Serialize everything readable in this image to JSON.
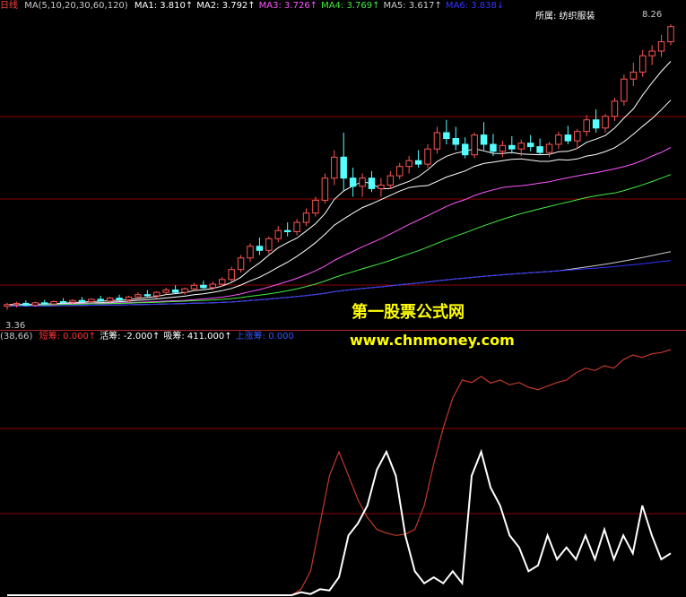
{
  "header_top": {
    "period": "日线",
    "ma_label": "MA(5,10,20,30,60,120)",
    "items": [
      {
        "name": "MA1:",
        "value": "3.810",
        "arrow": "↑",
        "color": "#ffffff"
      },
      {
        "name": "MA2:",
        "value": "3.792",
        "arrow": "↑",
        "color": "#ffffff"
      },
      {
        "name": "MA3:",
        "value": "3.726",
        "arrow": "↑",
        "color": "#ff55ff"
      },
      {
        "name": "MA4:",
        "value": "3.769",
        "arrow": "↑",
        "color": "#44ee44"
      },
      {
        "name": "MA5:",
        "value": "3.617",
        "arrow": "↑",
        "color": "#cccccc"
      },
      {
        "name": "MA6:",
        "value": "3.838",
        "arrow": "↓",
        "color": "#3333ff"
      }
    ]
  },
  "industry": "所属: 纺织服装",
  "high_label": "8.26",
  "low_label": "3.36",
  "header_bottom": {
    "params": "(38,66)",
    "items": [
      {
        "name": "短筹:",
        "value": "0.000",
        "arrow": "↑",
        "color": "#ff3333"
      },
      {
        "name": "活筹:",
        "value": "-2.000",
        "arrow": "↑",
        "color": "#ffffff"
      },
      {
        "name": "吸筹:",
        "value": "411.000",
        "arrow": "↑",
        "color": "#ffffff"
      },
      {
        "name": "上涨筹:",
        "value": "0.000",
        "arrow": "",
        "color": "#3355ff"
      }
    ]
  },
  "watermark": {
    "line1": "第一股票公式网",
    "line2": "www.chnmoney.com"
  },
  "colors": {
    "up": "#ff5555",
    "down": "#55ffff",
    "grid": "#8b0000",
    "ma1": "#ffffff",
    "ma3": "#ff55ff",
    "ma4": "#44ee44",
    "ma5": "#cccccc",
    "ma6": "#3333ff",
    "osc_white": "#ffffff",
    "osc_red": "#c0392b"
  },
  "chart_data": [
    {
      "type": "candlestick",
      "ylim": [
        3.2,
        8.4
      ],
      "log_scale": false,
      "candles": [
        {
          "o": 3.42,
          "h": 3.48,
          "l": 3.36,
          "c": 3.45
        },
        {
          "o": 3.45,
          "h": 3.5,
          "l": 3.4,
          "c": 3.47
        },
        {
          "o": 3.47,
          "h": 3.52,
          "l": 3.42,
          "c": 3.44
        },
        {
          "o": 3.44,
          "h": 3.5,
          "l": 3.41,
          "c": 3.48
        },
        {
          "o": 3.48,
          "h": 3.53,
          "l": 3.44,
          "c": 3.46
        },
        {
          "o": 3.46,
          "h": 3.52,
          "l": 3.43,
          "c": 3.5
        },
        {
          "o": 3.5,
          "h": 3.56,
          "l": 3.46,
          "c": 3.49
        },
        {
          "o": 3.49,
          "h": 3.54,
          "l": 3.45,
          "c": 3.52
        },
        {
          "o": 3.52,
          "h": 3.58,
          "l": 3.48,
          "c": 3.5
        },
        {
          "o": 3.5,
          "h": 3.56,
          "l": 3.47,
          "c": 3.54
        },
        {
          "o": 3.54,
          "h": 3.6,
          "l": 3.5,
          "c": 3.51
        },
        {
          "o": 3.51,
          "h": 3.58,
          "l": 3.48,
          "c": 3.56
        },
        {
          "o": 3.56,
          "h": 3.62,
          "l": 3.52,
          "c": 3.53
        },
        {
          "o": 3.53,
          "h": 3.6,
          "l": 3.5,
          "c": 3.58
        },
        {
          "o": 3.58,
          "h": 3.66,
          "l": 3.54,
          "c": 3.62
        },
        {
          "o": 3.62,
          "h": 3.7,
          "l": 3.58,
          "c": 3.6
        },
        {
          "o": 3.6,
          "h": 3.68,
          "l": 3.56,
          "c": 3.66
        },
        {
          "o": 3.66,
          "h": 3.74,
          "l": 3.62,
          "c": 3.7
        },
        {
          "o": 3.7,
          "h": 3.78,
          "l": 3.64,
          "c": 3.66
        },
        {
          "o": 3.66,
          "h": 3.74,
          "l": 3.62,
          "c": 3.72
        },
        {
          "o": 3.72,
          "h": 3.82,
          "l": 3.68,
          "c": 3.78
        },
        {
          "o": 3.78,
          "h": 3.86,
          "l": 3.72,
          "c": 3.74
        },
        {
          "o": 3.74,
          "h": 3.84,
          "l": 3.7,
          "c": 3.8
        },
        {
          "o": 3.8,
          "h": 3.92,
          "l": 3.76,
          "c": 3.88
        },
        {
          "o": 3.88,
          "h": 4.1,
          "l": 3.84,
          "c": 4.05
        },
        {
          "o": 4.05,
          "h": 4.3,
          "l": 4.0,
          "c": 4.25
        },
        {
          "o": 4.25,
          "h": 4.5,
          "l": 4.18,
          "c": 4.45
        },
        {
          "o": 4.45,
          "h": 4.6,
          "l": 4.3,
          "c": 4.38
        },
        {
          "o": 4.38,
          "h": 4.62,
          "l": 4.32,
          "c": 4.58
        },
        {
          "o": 4.58,
          "h": 4.8,
          "l": 4.52,
          "c": 4.72
        },
        {
          "o": 4.72,
          "h": 4.86,
          "l": 4.62,
          "c": 4.7
        },
        {
          "o": 4.7,
          "h": 4.92,
          "l": 4.64,
          "c": 4.86
        },
        {
          "o": 4.86,
          "h": 5.1,
          "l": 4.8,
          "c": 5.02
        },
        {
          "o": 5.02,
          "h": 5.3,
          "l": 4.96,
          "c": 5.24
        },
        {
          "o": 5.24,
          "h": 5.7,
          "l": 5.18,
          "c": 5.62
        },
        {
          "o": 5.62,
          "h": 6.1,
          "l": 5.5,
          "c": 5.98
        },
        {
          "o": 5.98,
          "h": 6.4,
          "l": 5.4,
          "c": 5.62
        },
        {
          "o": 5.62,
          "h": 5.8,
          "l": 5.3,
          "c": 5.48
        },
        {
          "o": 5.48,
          "h": 5.7,
          "l": 5.3,
          "c": 5.62
        },
        {
          "o": 5.62,
          "h": 5.74,
          "l": 5.38,
          "c": 5.44
        },
        {
          "o": 5.44,
          "h": 5.62,
          "l": 5.3,
          "c": 5.5
        },
        {
          "o": 5.5,
          "h": 5.74,
          "l": 5.44,
          "c": 5.66
        },
        {
          "o": 5.66,
          "h": 5.88,
          "l": 5.6,
          "c": 5.82
        },
        {
          "o": 5.82,
          "h": 6.0,
          "l": 5.7,
          "c": 5.92
        },
        {
          "o": 5.92,
          "h": 6.1,
          "l": 5.8,
          "c": 5.86
        },
        {
          "o": 5.86,
          "h": 6.2,
          "l": 5.8,
          "c": 6.12
        },
        {
          "o": 6.12,
          "h": 6.5,
          "l": 6.04,
          "c": 6.4
        },
        {
          "o": 6.4,
          "h": 6.62,
          "l": 6.2,
          "c": 6.3
        },
        {
          "o": 6.3,
          "h": 6.5,
          "l": 6.1,
          "c": 6.2
        },
        {
          "o": 6.2,
          "h": 6.32,
          "l": 5.96,
          "c": 6.02
        },
        {
          "o": 6.02,
          "h": 6.4,
          "l": 5.96,
          "c": 6.36
        },
        {
          "o": 6.36,
          "h": 6.58,
          "l": 6.1,
          "c": 6.2
        },
        {
          "o": 6.2,
          "h": 6.38,
          "l": 6.0,
          "c": 6.08
        },
        {
          "o": 6.08,
          "h": 6.26,
          "l": 5.98,
          "c": 6.18
        },
        {
          "o": 6.18,
          "h": 6.34,
          "l": 6.04,
          "c": 6.12
        },
        {
          "o": 6.12,
          "h": 6.28,
          "l": 6.0,
          "c": 6.22
        },
        {
          "o": 6.22,
          "h": 6.36,
          "l": 6.08,
          "c": 6.16
        },
        {
          "o": 6.16,
          "h": 6.3,
          "l": 6.02,
          "c": 6.06
        },
        {
          "o": 6.06,
          "h": 6.24,
          "l": 5.98,
          "c": 6.2
        },
        {
          "o": 6.2,
          "h": 6.42,
          "l": 6.12,
          "c": 6.36
        },
        {
          "o": 6.36,
          "h": 6.52,
          "l": 6.2,
          "c": 6.26
        },
        {
          "o": 6.26,
          "h": 6.46,
          "l": 6.12,
          "c": 6.42
        },
        {
          "o": 6.42,
          "h": 6.7,
          "l": 6.34,
          "c": 6.62
        },
        {
          "o": 6.62,
          "h": 6.8,
          "l": 6.4,
          "c": 6.48
        },
        {
          "o": 6.48,
          "h": 6.72,
          "l": 6.4,
          "c": 6.68
        },
        {
          "o": 6.68,
          "h": 7.0,
          "l": 6.6,
          "c": 6.94
        },
        {
          "o": 6.94,
          "h": 7.4,
          "l": 6.86,
          "c": 7.32
        },
        {
          "o": 7.32,
          "h": 7.6,
          "l": 7.2,
          "c": 7.44
        },
        {
          "o": 7.44,
          "h": 7.82,
          "l": 7.36,
          "c": 7.72
        },
        {
          "o": 7.72,
          "h": 7.9,
          "l": 7.56,
          "c": 7.8
        },
        {
          "o": 7.8,
          "h": 8.08,
          "l": 7.7,
          "c": 7.96
        },
        {
          "o": 7.96,
          "h": 8.26,
          "l": 7.9,
          "c": 8.22
        }
      ],
      "ma": [
        {
          "name": "MA1",
          "period": 5,
          "color_key": "ma1"
        },
        {
          "name": "MA2",
          "period": 10,
          "color_key": "ma1"
        },
        {
          "name": "MA3",
          "period": 20,
          "color_key": "ma3"
        },
        {
          "name": "MA4",
          "period": 30,
          "color_key": "ma4"
        },
        {
          "name": "MA5",
          "period": 60,
          "color_key": "ma5"
        },
        {
          "name": "MA6",
          "period": 120,
          "color_key": "ma6"
        }
      ]
    },
    {
      "type": "line",
      "ylim": [
        0,
        420
      ],
      "series": [
        {
          "name": "吸筹",
          "color_key": "osc_red",
          "values": [
            0,
            0,
            0,
            0,
            0,
            0,
            0,
            0,
            0,
            0,
            0,
            0,
            0,
            0,
            0,
            0,
            0,
            0,
            0,
            0,
            0,
            0,
            0,
            0,
            0,
            0,
            0,
            0,
            0,
            0,
            0,
            10,
            40,
            120,
            200,
            240,
            200,
            160,
            130,
            110,
            104,
            100,
            102,
            110,
            150,
            220,
            280,
            330,
            360,
            356,
            366,
            355,
            360,
            352,
            356,
            348,
            344,
            350,
            356,
            360,
            372,
            380,
            376,
            384,
            380,
            394,
            402,
            398,
            404,
            406,
            411
          ]
        },
        {
          "name": "活筹",
          "color_key": "osc_white",
          "values": [
            0,
            0,
            0,
            0,
            0,
            0,
            0,
            0,
            0,
            0,
            0,
            0,
            0,
            0,
            0,
            0,
            0,
            0,
            0,
            0,
            0,
            0,
            0,
            0,
            0,
            0,
            0,
            0,
            0,
            0,
            0,
            5,
            2,
            10,
            8,
            30,
            100,
            120,
            150,
            210,
            240,
            200,
            100,
            40,
            20,
            30,
            20,
            40,
            20,
            200,
            240,
            180,
            150,
            100,
            80,
            40,
            50,
            100,
            60,
            80,
            60,
            100,
            60,
            110,
            60,
            100,
            70,
            150,
            100,
            60,
            70
          ]
        }
      ]
    }
  ]
}
